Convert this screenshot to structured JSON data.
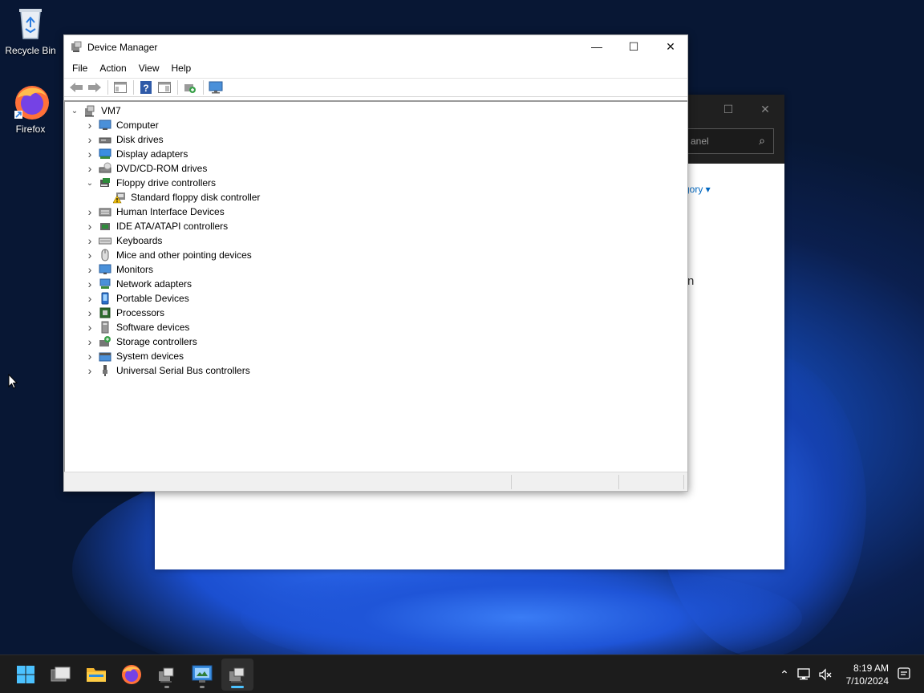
{
  "desktop": {
    "icons": [
      {
        "label": "Recycle Bin",
        "icon": "recycle-bin-icon"
      },
      {
        "label": "Firefox",
        "icon": "firefox-icon"
      }
    ]
  },
  "background_window": {
    "search_placeholder": "Panel",
    "search_partial": "anel",
    "view_by_fragment": "gory",
    "text_fragment": "n"
  },
  "device_manager": {
    "title": "Device Manager",
    "menu": [
      "File",
      "Action",
      "View",
      "Help"
    ],
    "toolbar": [
      "back-icon",
      "forward-icon",
      "properties-pane-icon",
      "help-icon",
      "show-hide-icon",
      "scan-hardware-icon",
      "monitor-icon"
    ],
    "root": "VM7",
    "categories": [
      {
        "label": "Computer",
        "icon": "computer-icon",
        "expanded": false
      },
      {
        "label": "Disk drives",
        "icon": "disk-drive-icon",
        "expanded": false
      },
      {
        "label": "Display adapters",
        "icon": "display-adapter-icon",
        "expanded": false
      },
      {
        "label": "DVD/CD-ROM drives",
        "icon": "dvd-drive-icon",
        "expanded": false
      },
      {
        "label": "Floppy drive controllers",
        "icon": "floppy-controller-icon",
        "expanded": true
      },
      {
        "label": "Standard floppy disk controller",
        "icon": "warning-device-icon",
        "child": true
      },
      {
        "label": "Human Interface Devices",
        "icon": "hid-icon",
        "expanded": false
      },
      {
        "label": "IDE ATA/ATAPI controllers",
        "icon": "ide-controller-icon",
        "expanded": false
      },
      {
        "label": "Keyboards",
        "icon": "keyboard-icon",
        "expanded": false
      },
      {
        "label": "Mice and other pointing devices",
        "icon": "mouse-icon",
        "expanded": false
      },
      {
        "label": "Monitors",
        "icon": "monitor-icon",
        "expanded": false
      },
      {
        "label": "Network adapters",
        "icon": "network-adapter-icon",
        "expanded": false
      },
      {
        "label": "Portable Devices",
        "icon": "portable-device-icon",
        "expanded": false
      },
      {
        "label": "Processors",
        "icon": "processor-icon",
        "expanded": false
      },
      {
        "label": "Software devices",
        "icon": "software-device-icon",
        "expanded": false
      },
      {
        "label": "Storage controllers",
        "icon": "storage-controller-icon",
        "expanded": false
      },
      {
        "label": "System devices",
        "icon": "system-device-icon",
        "expanded": false
      },
      {
        "label": "Universal Serial Bus controllers",
        "icon": "usb-icon",
        "expanded": false
      }
    ]
  },
  "taskbar": {
    "apps": [
      "start-icon",
      "task-view-icon",
      "file-explorer-icon",
      "firefox-icon",
      "device-manager-icon",
      "control-panel-icon",
      "device-manager-active-icon"
    ],
    "time": "8:19 AM",
    "date": "7/10/2024"
  },
  "colors": {
    "accent": "#4cc2ff",
    "taskbar": "#1c1c1c",
    "link": "#0067c0"
  }
}
